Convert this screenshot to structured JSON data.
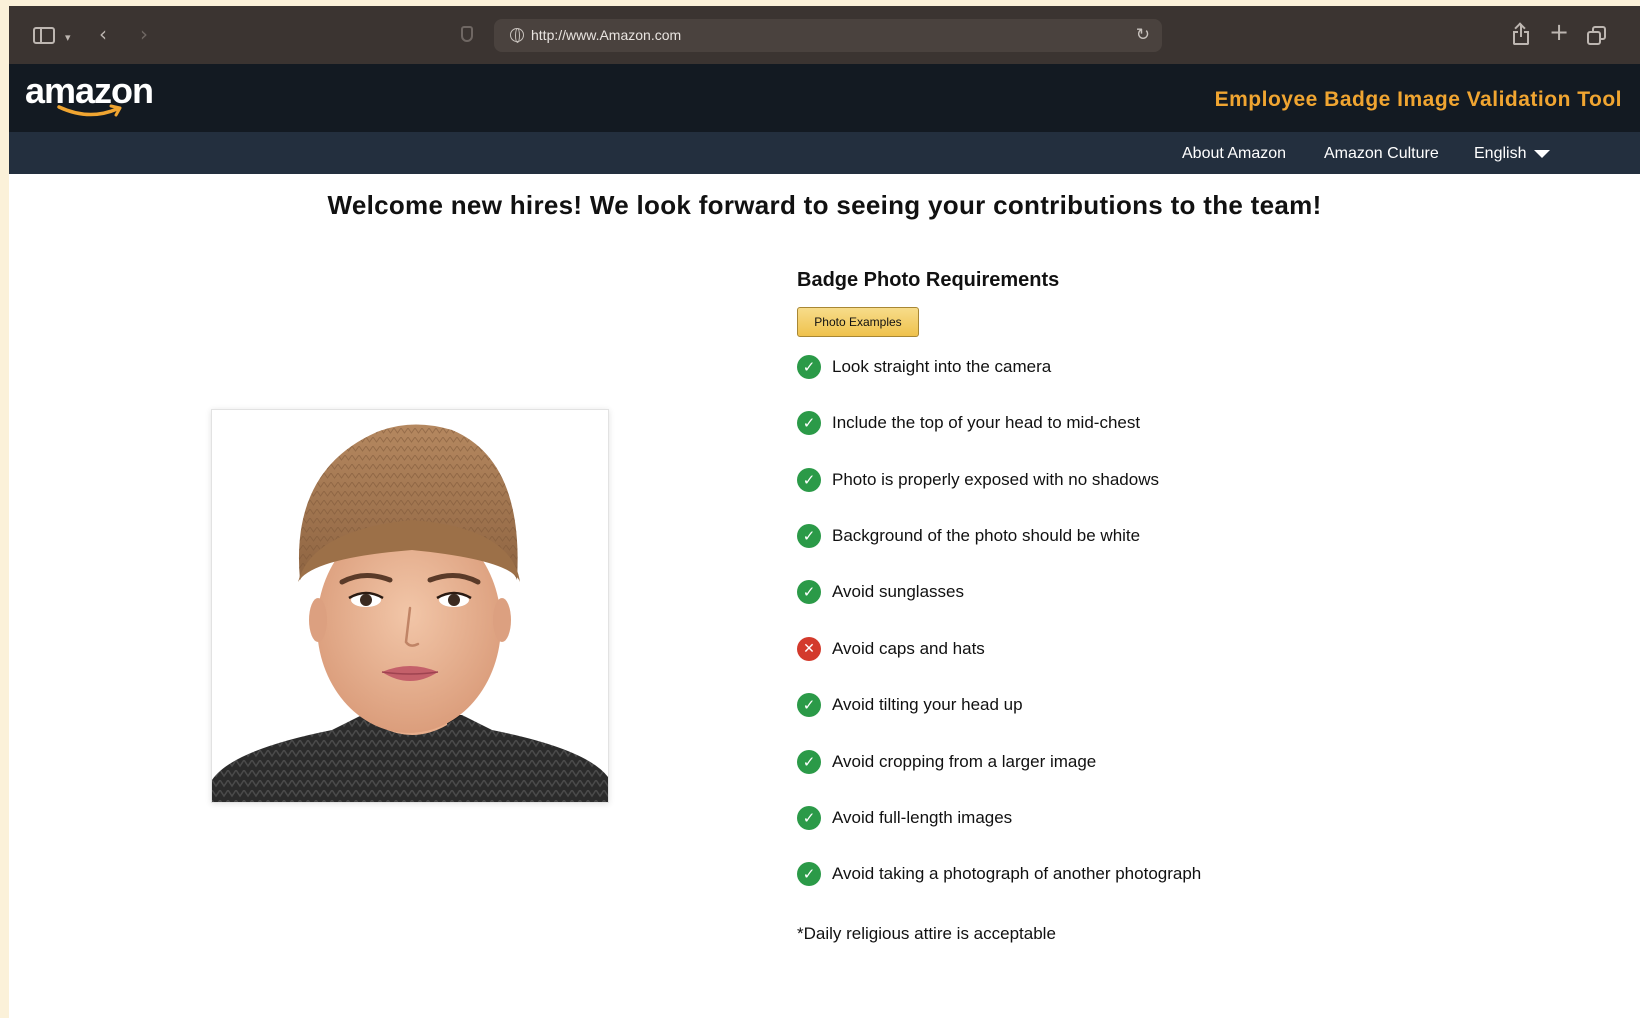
{
  "browser": {
    "url": "http://www.Amazon.com"
  },
  "header": {
    "logo_text": "amazon",
    "tool_title": "Employee Badge Image Validation Tool",
    "brand_accent": "#f0a531"
  },
  "subnav": {
    "items": [
      {
        "label": "About Amazon"
      },
      {
        "label": "Amazon Culture"
      },
      {
        "label": "English"
      }
    ]
  },
  "main": {
    "welcome": "Welcome new hires! We look forward to seeing your contributions to the team!",
    "requirements_title": "Badge Photo Requirements",
    "examples_button": "Photo Examples",
    "requirements": [
      {
        "text": "Look straight into the camera",
        "status": "pass"
      },
      {
        "text": "Include the top of your head to mid-chest",
        "status": "pass"
      },
      {
        "text": "Photo is properly exposed with no shadows",
        "status": "pass"
      },
      {
        "text": "Background of the photo should be white",
        "status": "pass"
      },
      {
        "text": "Avoid sunglasses",
        "status": "pass"
      },
      {
        "text": "Avoid caps and hats",
        "status": "fail"
      },
      {
        "text": "Avoid tilting your head up",
        "status": "pass"
      },
      {
        "text": "Avoid cropping from a larger image",
        "status": "pass"
      },
      {
        "text": "Avoid full-length images",
        "status": "pass"
      },
      {
        "text": "Avoid taking a photograph of another photograph",
        "status": "pass"
      }
    ],
    "note": "*Daily religious attire is acceptable",
    "status_colors": {
      "pass": "#2b9a48",
      "fail": "#d33a2c"
    }
  }
}
